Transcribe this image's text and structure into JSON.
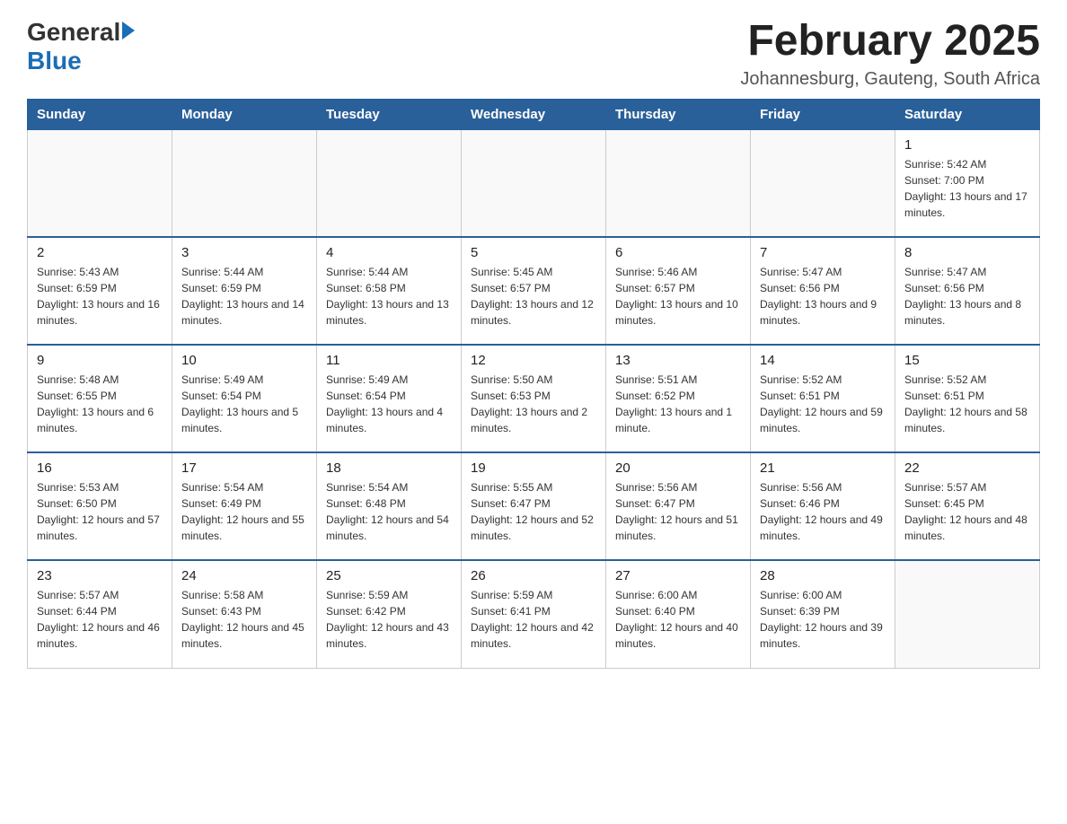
{
  "header": {
    "logo": {
      "general": "General",
      "blue": "Blue"
    },
    "title": "February 2025",
    "location": "Johannesburg, Gauteng, South Africa"
  },
  "calendar": {
    "days_of_week": [
      "Sunday",
      "Monday",
      "Tuesday",
      "Wednesday",
      "Thursday",
      "Friday",
      "Saturday"
    ],
    "weeks": [
      [
        {
          "day": "",
          "info": ""
        },
        {
          "day": "",
          "info": ""
        },
        {
          "day": "",
          "info": ""
        },
        {
          "day": "",
          "info": ""
        },
        {
          "day": "",
          "info": ""
        },
        {
          "day": "",
          "info": ""
        },
        {
          "day": "1",
          "info": "Sunrise: 5:42 AM\nSunset: 7:00 PM\nDaylight: 13 hours and 17 minutes."
        }
      ],
      [
        {
          "day": "2",
          "info": "Sunrise: 5:43 AM\nSunset: 6:59 PM\nDaylight: 13 hours and 16 minutes."
        },
        {
          "day": "3",
          "info": "Sunrise: 5:44 AM\nSunset: 6:59 PM\nDaylight: 13 hours and 14 minutes."
        },
        {
          "day": "4",
          "info": "Sunrise: 5:44 AM\nSunset: 6:58 PM\nDaylight: 13 hours and 13 minutes."
        },
        {
          "day": "5",
          "info": "Sunrise: 5:45 AM\nSunset: 6:57 PM\nDaylight: 13 hours and 12 minutes."
        },
        {
          "day": "6",
          "info": "Sunrise: 5:46 AM\nSunset: 6:57 PM\nDaylight: 13 hours and 10 minutes."
        },
        {
          "day": "7",
          "info": "Sunrise: 5:47 AM\nSunset: 6:56 PM\nDaylight: 13 hours and 9 minutes."
        },
        {
          "day": "8",
          "info": "Sunrise: 5:47 AM\nSunset: 6:56 PM\nDaylight: 13 hours and 8 minutes."
        }
      ],
      [
        {
          "day": "9",
          "info": "Sunrise: 5:48 AM\nSunset: 6:55 PM\nDaylight: 13 hours and 6 minutes."
        },
        {
          "day": "10",
          "info": "Sunrise: 5:49 AM\nSunset: 6:54 PM\nDaylight: 13 hours and 5 minutes."
        },
        {
          "day": "11",
          "info": "Sunrise: 5:49 AM\nSunset: 6:54 PM\nDaylight: 13 hours and 4 minutes."
        },
        {
          "day": "12",
          "info": "Sunrise: 5:50 AM\nSunset: 6:53 PM\nDaylight: 13 hours and 2 minutes."
        },
        {
          "day": "13",
          "info": "Sunrise: 5:51 AM\nSunset: 6:52 PM\nDaylight: 13 hours and 1 minute."
        },
        {
          "day": "14",
          "info": "Sunrise: 5:52 AM\nSunset: 6:51 PM\nDaylight: 12 hours and 59 minutes."
        },
        {
          "day": "15",
          "info": "Sunrise: 5:52 AM\nSunset: 6:51 PM\nDaylight: 12 hours and 58 minutes."
        }
      ],
      [
        {
          "day": "16",
          "info": "Sunrise: 5:53 AM\nSunset: 6:50 PM\nDaylight: 12 hours and 57 minutes."
        },
        {
          "day": "17",
          "info": "Sunrise: 5:54 AM\nSunset: 6:49 PM\nDaylight: 12 hours and 55 minutes."
        },
        {
          "day": "18",
          "info": "Sunrise: 5:54 AM\nSunset: 6:48 PM\nDaylight: 12 hours and 54 minutes."
        },
        {
          "day": "19",
          "info": "Sunrise: 5:55 AM\nSunset: 6:47 PM\nDaylight: 12 hours and 52 minutes."
        },
        {
          "day": "20",
          "info": "Sunrise: 5:56 AM\nSunset: 6:47 PM\nDaylight: 12 hours and 51 minutes."
        },
        {
          "day": "21",
          "info": "Sunrise: 5:56 AM\nSunset: 6:46 PM\nDaylight: 12 hours and 49 minutes."
        },
        {
          "day": "22",
          "info": "Sunrise: 5:57 AM\nSunset: 6:45 PM\nDaylight: 12 hours and 48 minutes."
        }
      ],
      [
        {
          "day": "23",
          "info": "Sunrise: 5:57 AM\nSunset: 6:44 PM\nDaylight: 12 hours and 46 minutes."
        },
        {
          "day": "24",
          "info": "Sunrise: 5:58 AM\nSunset: 6:43 PM\nDaylight: 12 hours and 45 minutes."
        },
        {
          "day": "25",
          "info": "Sunrise: 5:59 AM\nSunset: 6:42 PM\nDaylight: 12 hours and 43 minutes."
        },
        {
          "day": "26",
          "info": "Sunrise: 5:59 AM\nSunset: 6:41 PM\nDaylight: 12 hours and 42 minutes."
        },
        {
          "day": "27",
          "info": "Sunrise: 6:00 AM\nSunset: 6:40 PM\nDaylight: 12 hours and 40 minutes."
        },
        {
          "day": "28",
          "info": "Sunrise: 6:00 AM\nSunset: 6:39 PM\nDaylight: 12 hours and 39 minutes."
        },
        {
          "day": "",
          "info": ""
        }
      ]
    ]
  }
}
